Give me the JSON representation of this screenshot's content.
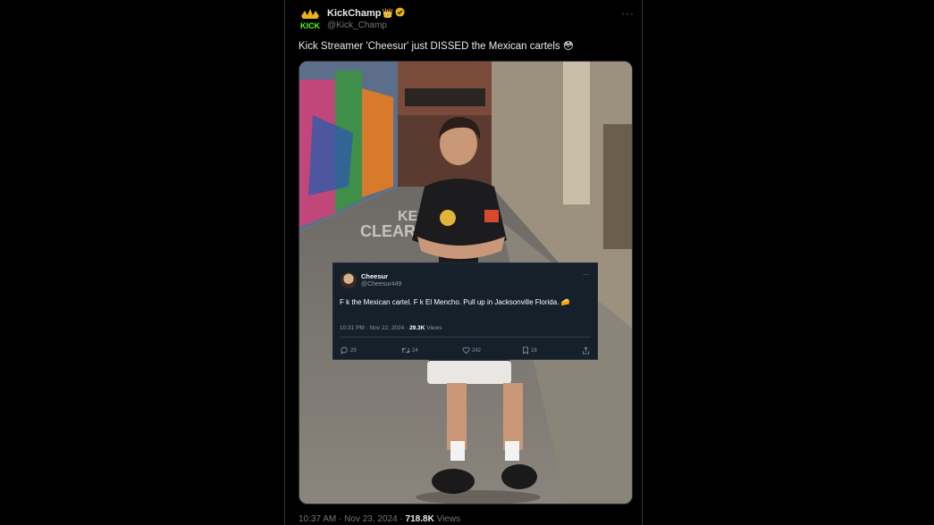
{
  "tweet": {
    "author_name": "KickChamp",
    "author_emoji": "👑",
    "author_handle": "@Kick_Champ",
    "logo_text": "KICK",
    "more_icon": "···",
    "text": "Kick Streamer 'Cheesur' just DISSED the Mexican cartels 😳",
    "time": "10:37 AM",
    "date": "Nov 23, 2024",
    "views_count": "718.8K",
    "views_label": "Views"
  },
  "embed": {
    "name": "Cheesur",
    "handle": "@Cheesur449",
    "more_icon": "···",
    "text": "F    k the Mexican cartel. F    k El Mencho. Pull up in Jacksonville Florida. 🧀",
    "time": "10:31 PM",
    "date": "Nov 22, 2024",
    "views_count": "29.3K",
    "views_label": "Views",
    "replies": "29",
    "retweets": "24",
    "likes": "242",
    "bookmarks": "18"
  },
  "colors": {
    "background": "#000000",
    "text": "#e7e9ea",
    "muted": "#71767b",
    "verified": "#e8b513",
    "kick_green": "#53fc18",
    "embed_bg": "#15202b"
  },
  "icons": [
    "crown-icon",
    "verified-badge-icon",
    "more-icon",
    "reply-icon",
    "retweet-icon",
    "like-icon",
    "bookmark-icon",
    "share-icon"
  ]
}
